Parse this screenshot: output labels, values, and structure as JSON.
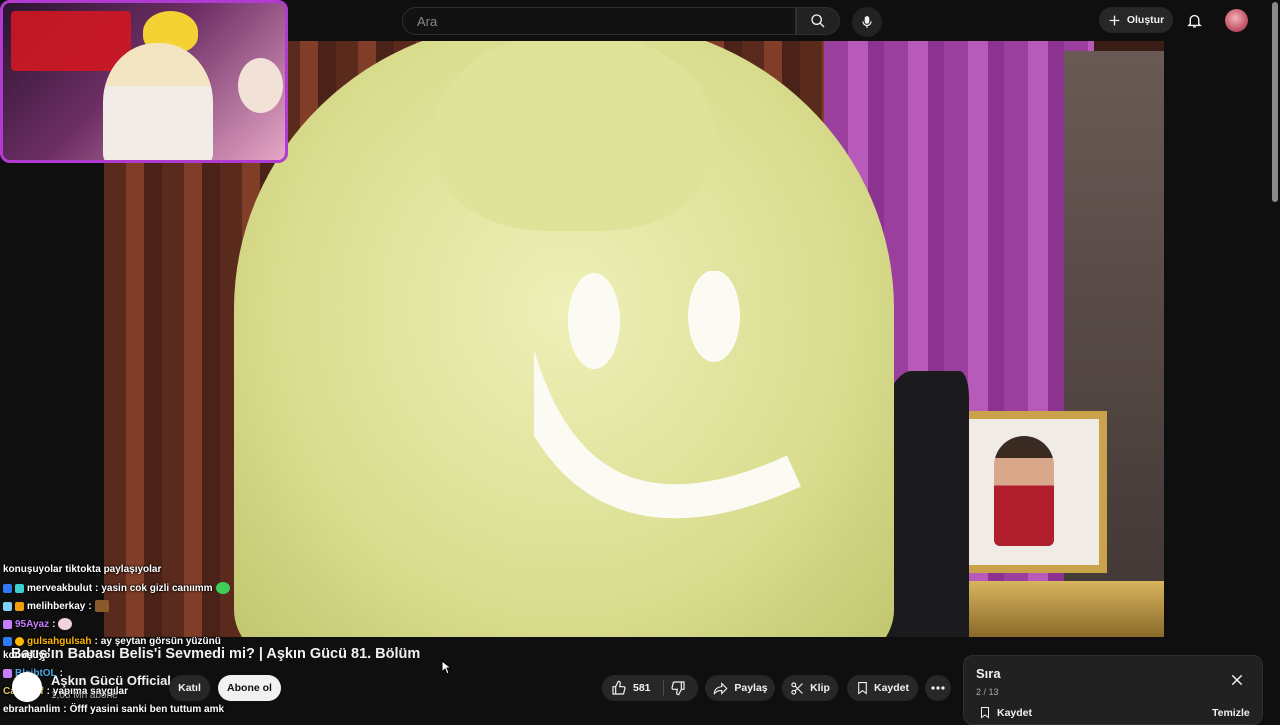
{
  "search": {
    "placeholder": "Ara"
  },
  "header": {
    "create_label": "Oluştur"
  },
  "video": {
    "title": "Barış'ın Babası Belis'i Sevmedi mi? | Aşkın Gücü 81. Bölüm"
  },
  "channel": {
    "name": "Aşkın Gücü Official",
    "subscribers": "1,05 Mn abone"
  },
  "actions": {
    "join": "Katıl",
    "subscribe": "Abone ol",
    "likes": "581",
    "share": "Paylaş",
    "clip": "Klip",
    "save": "Kaydet"
  },
  "queue": {
    "title": "Sıra",
    "count": "2 / 13",
    "save": "Kaydet",
    "clear": "Temizle"
  },
  "chat": [
    {
      "user": "",
      "message": "konuşuyolar tiktokta paylaşıyolar",
      "color": "#ffffff"
    },
    {
      "user": "merveakbulut",
      "message": "yasin cok gizli canıımm",
      "color": "#ffffff"
    },
    {
      "user": "melihberkay",
      "message": "",
      "color": "#ffffff"
    },
    {
      "user": "95Ayaz",
      "message": "",
      "color": "#c77dff"
    },
    {
      "user": "gulsahgulsah",
      "message": "ay şeytan görsün yüzünü",
      "color": "#ffb703"
    },
    {
      "user": "",
      "message": "konuşuyo",
      "color": "#ffffff"
    },
    {
      "user": "BleibtOL",
      "message": "",
      "color": "#4ea8de"
    },
    {
      "user": "CagKeyf",
      "message": "yapıma saygılar",
      "color": "#e9c46a"
    },
    {
      "user": "ebrarhanlim",
      "message": "Öfff yasini sanki ben tuttum amk",
      "color": "#ffffff"
    }
  ]
}
